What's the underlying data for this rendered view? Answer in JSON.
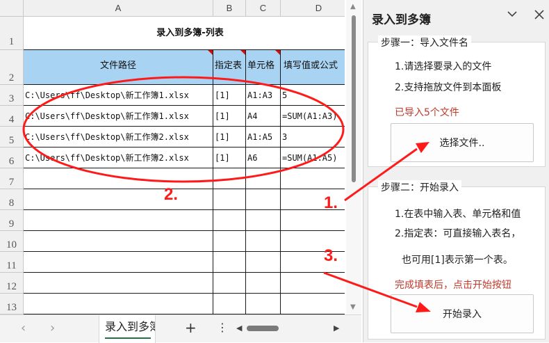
{
  "sheet": {
    "columns": [
      "A",
      "B",
      "C",
      "D"
    ],
    "rows": [
      "1",
      "2",
      "3",
      "4",
      "5",
      "6",
      "7",
      "8",
      "9",
      "10",
      "11",
      "12",
      "13"
    ],
    "title": "录入到多簿-列表",
    "headers": [
      "文件路径",
      "指定表",
      "单元格",
      "填写值或公式"
    ],
    "data": [
      [
        "C:\\Users\\ff\\Desktop\\新工作簿1.xlsx",
        "[1]",
        "A1:A3",
        "5"
      ],
      [
        "C:\\Users\\ff\\Desktop\\新工作簿1.xlsx",
        "[1]",
        "A4",
        "=SUM(A1:A3)"
      ],
      [
        "C:\\Users\\ff\\Desktop\\新工作簿2.xlsx",
        "[1]",
        "A1:A5",
        "3"
      ],
      [
        "C:\\Users\\ff\\Desktop\\新工作簿2.xlsx",
        "[1]",
        "A6",
        "=SUM(A1:A5)"
      ]
    ],
    "tab_name": "录入到多簿"
  },
  "panel": {
    "title": "录入到多簿",
    "step1": {
      "legend": "步骤一：导入文件名",
      "line1": "1.请选择要录入的文件",
      "line2": "2.支持拖放文件到本面板",
      "status": "已导入5个文件",
      "button": "选择文件.."
    },
    "step2": {
      "legend": "步骤二：开始录入",
      "line1": "1.在表中输入表、单元格和值",
      "line2": "2.指定表：可直接输入表名，",
      "line3": "也可用[1]表示第一个表。",
      "status": "完成填表后，点击开始按钮",
      "button": "开始录入"
    }
  },
  "annotations": [
    "1.",
    "2.",
    "3."
  ],
  "colors": {
    "header_fill": "#a9d3f3",
    "status_red": "#c0392b",
    "annotation_red": "#ff1a1a"
  }
}
